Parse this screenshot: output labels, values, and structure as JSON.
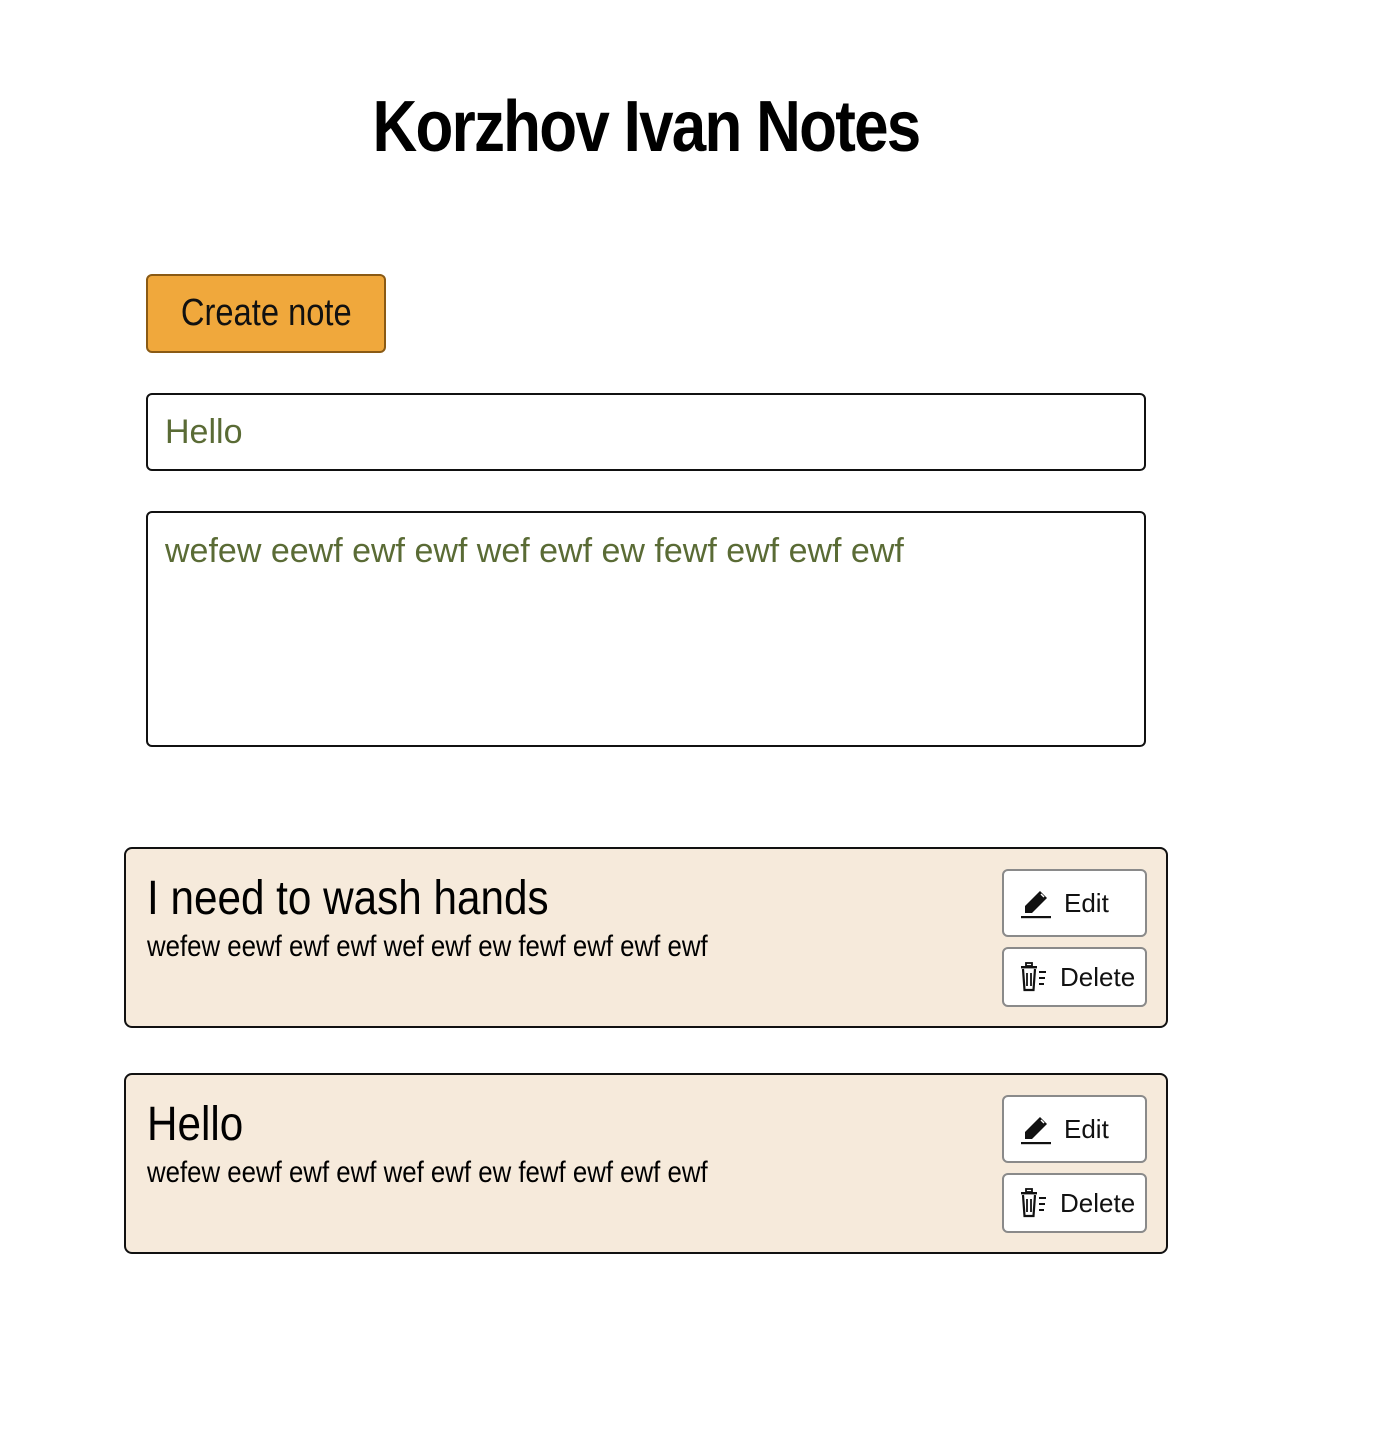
{
  "header": {
    "title": "Korzhov Ivan Notes"
  },
  "form": {
    "create_label": "Create note",
    "title_value": "Hello",
    "text_value": "wefew eewf ewf ewf wef ewf ew fewf ewf ewf ewf"
  },
  "notes": [
    {
      "title": "I need to wash hands",
      "text": "wefew eewf ewf ewf wef ewf ew fewf ewf ewf ewf",
      "edit_label": "Edit",
      "delete_label": "Delete"
    },
    {
      "title": "Hello",
      "text": "wefew eewf ewf ewf wef ewf ew fewf ewf ewf ewf",
      "edit_label": "Edit",
      "delete_label": "Delete"
    }
  ],
  "colors": {
    "create_button": "#f0a83c",
    "note_background": "#f6eadb",
    "input_text": "#5a6b35"
  },
  "icons": {
    "edit": "pencil-icon",
    "delete": "trash-icon"
  }
}
